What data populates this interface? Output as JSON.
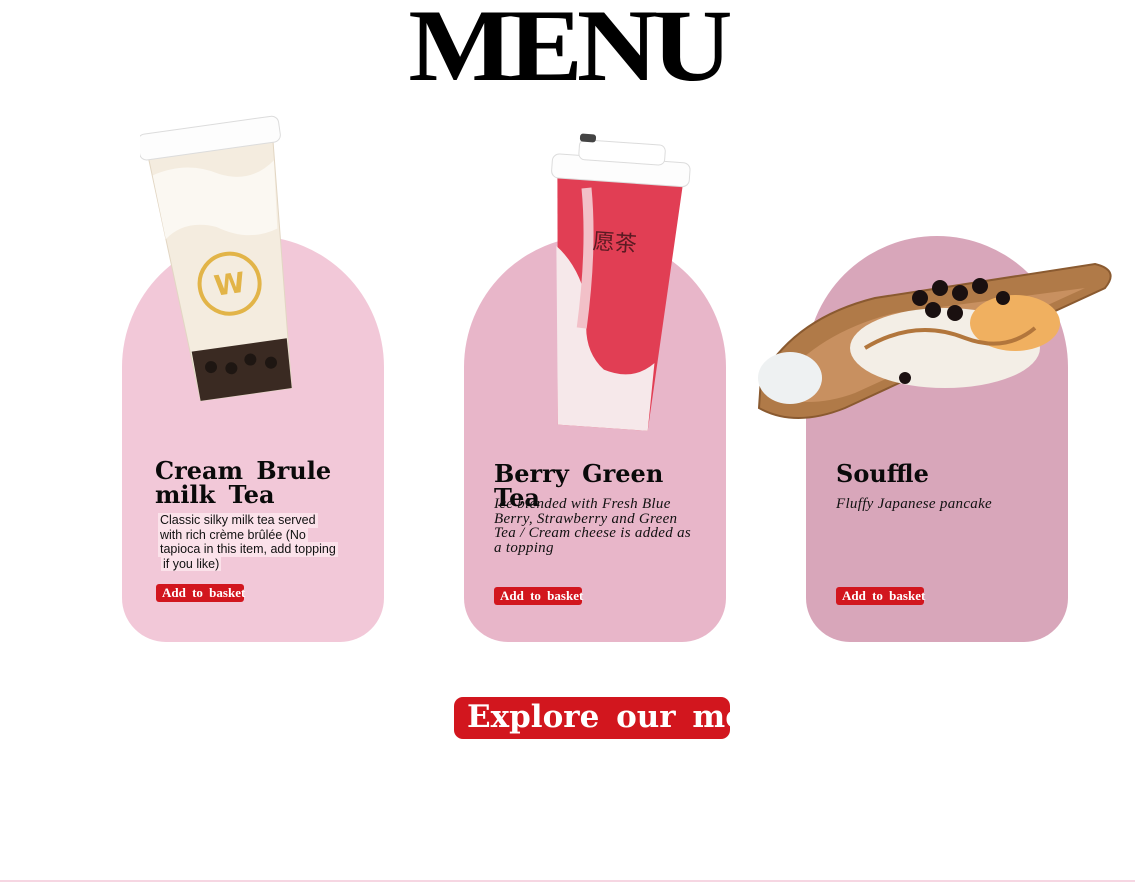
{
  "page": {
    "title": "MENU",
    "explore_button": "Explore our menu"
  },
  "colors": {
    "card_1": "#f2c8d8",
    "card_2": "#e8b6c9",
    "card_3": "#d8a6ba",
    "accent_red": "#d2161e"
  },
  "items": [
    {
      "title": "Cream Brule milk Tea",
      "description_lines": [
        "Classic silky milk tea served",
        "with rich crème brûlée (No",
        "tapioca in this item, add topping",
        "if you like)"
      ],
      "button": "Add to basket",
      "image": "cream-brule-milk-tea-cup"
    },
    {
      "title": "Berry Green Tea",
      "description": "Ice blended with Fresh Blue Berry, Strawberry and Green Tea / Cream cheese is added as a topping",
      "button": "Add to basket",
      "image": "berry-green-tea-cup",
      "cup_logo": "愿茶"
    },
    {
      "title": "Souffle",
      "description": "Fluffy Japanese pancake",
      "button": "Add to basket",
      "image": "souffle-pancake-plate"
    }
  ]
}
